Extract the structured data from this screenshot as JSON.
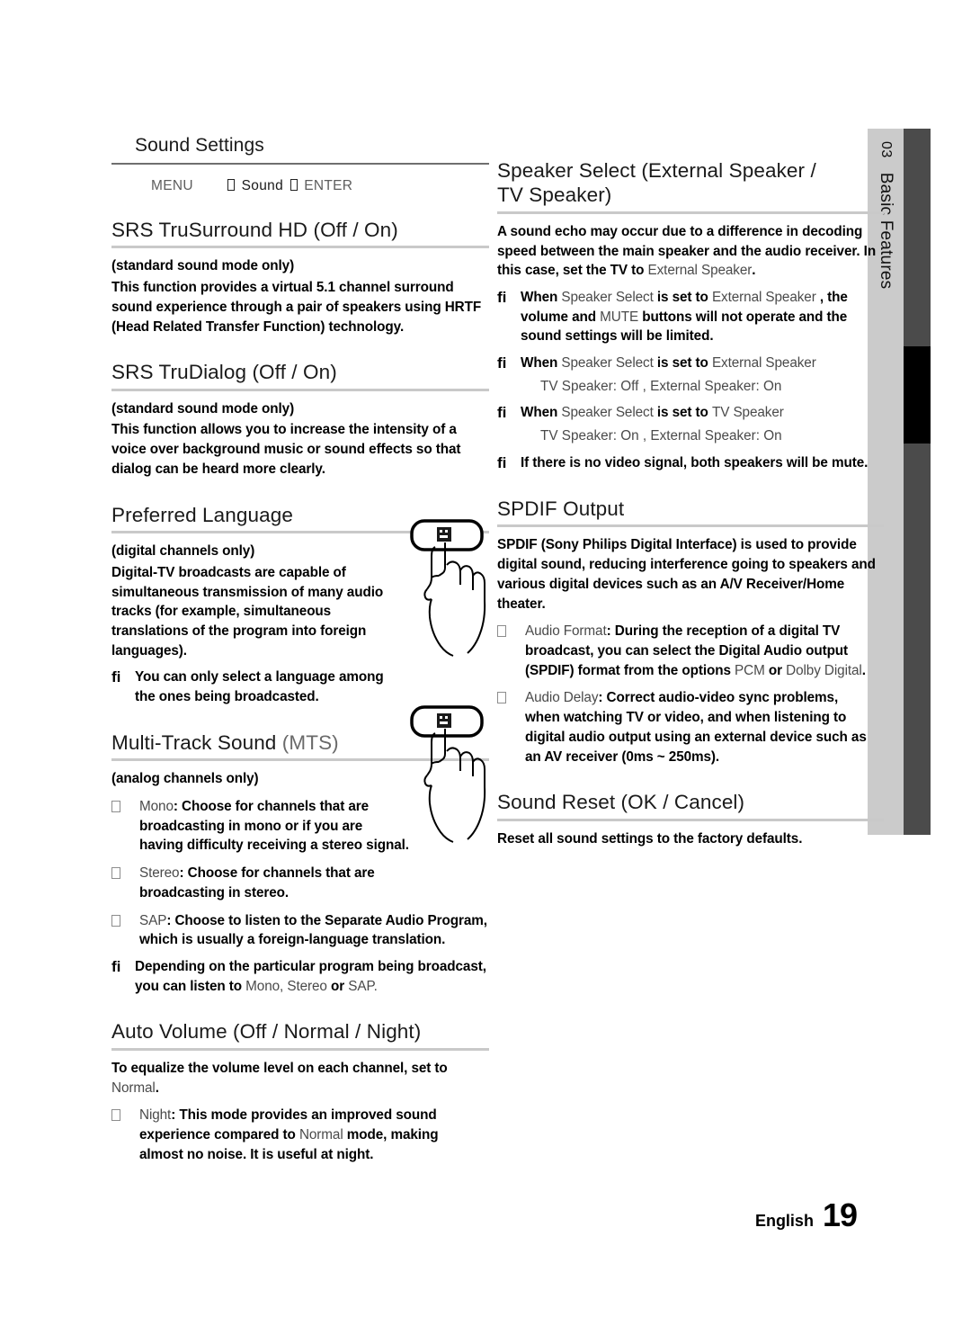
{
  "page": {
    "footer_language": "English",
    "footer_page_number": "19"
  },
  "side_tab": {
    "number": "03",
    "label": "Basic Features",
    "bg_color": "#cbcbcb",
    "bar_color": "#4b4b4b",
    "bar_accent_color": "#000000"
  },
  "section_box": {
    "title": "Sound Settings",
    "path_menu": "MENU",
    "path_middle": "Sound",
    "path_enter": "ENTER"
  },
  "left_column": {
    "srs_trusurround": {
      "heading": "SRS TruSurround HD (Off / On)",
      "note_mode": "(standard sound mode only)",
      "body": "This function provides a virtual 5.1 channel surround sound experience through a pair of speakers using HRTF (Head Related Transfer Function) technology."
    },
    "srs_trudialog": {
      "heading": "SRS TruDialog (Off / On)",
      "note_mode": "(standard sound mode only)",
      "body": "This function allows you to increase the intensity of a voice over background music or sound effects so that dialog can be heard more clearly."
    },
    "preferred_language": {
      "heading": "Preferred Language",
      "note_mode": "(digital channels only)",
      "body": "Digital-TV broadcasts are capable of simultaneous transmission of many audio tracks (for example, simultaneous translations of the program into foreign languages).",
      "note": "You can only select a language among the ones being broadcasted."
    },
    "multi_track_sound": {
      "heading_main": "Multi-Track Sound",
      "heading_light": "(MTS)",
      "note_mode": "(analog channels only)",
      "bullets": [
        {
          "term": "Mono",
          "text": ": Choose for channels that are broadcasting in mono or if you are having difficulty receiving a stereo signal."
        },
        {
          "term": "Stereo",
          "text": ": Choose for channels that are broadcasting in stereo."
        },
        {
          "term": "SAP",
          "text": ": Choose to listen to the Separate Audio Program, which is usually a foreign-language translation."
        }
      ],
      "note_prefix": "Depending on the particular program being broadcast, you can listen to ",
      "note_opt1": "Mono",
      "note_sep1": ", ",
      "note_opt2": "Stereo",
      "note_sep2": " or ",
      "note_opt3": "SAP",
      "note_suffix": "."
    },
    "auto_volume": {
      "heading": "Auto Volume (Off / Normal / Night)",
      "body_prefix": "To equalize the volume level on each channel, set to ",
      "body_value": "Normal",
      "body_suffix": ".",
      "bullet_term": "Night",
      "bullet_text_a": ": This mode provides an improved sound experience compared to ",
      "bullet_value": "Normal",
      "bullet_text_b": " mode, making almost no noise. It is useful at night."
    }
  },
  "right_column": {
    "speaker_select": {
      "heading": "Speaker Select (External Speaker / TV Speaker)",
      "body_prefix": "A sound echo may occur due to a difference in decoding speed between the main speaker and the audio receiver. In this case, set the TV to ",
      "body_value": "External Speaker",
      "body_suffix": ".",
      "note1_a": "When ",
      "note1_v1": "Speaker Select",
      "note1_b": " is set to ",
      "note1_v2": "External Speaker",
      "note1_c": " , the volume and ",
      "note1_v3": "MUTE",
      "note1_d": " buttons will not operate and the sound settings will be limited.",
      "note2_a": "When ",
      "note2_v1": "Speaker Select",
      "note2_b": " is set to ",
      "note2_v2": "External Speaker",
      "note2_sub": "TV Speaker: Off , External Speaker: On",
      "note3_a": "When ",
      "note3_v1": "Speaker Select",
      "note3_b": " is set to ",
      "note3_v2": "TV Speaker",
      "note3_sub": "TV Speaker: On , External Speaker: On",
      "note4": "If there is no video signal, both speakers will be mute."
    },
    "spdif_output": {
      "heading": "SPDIF Output",
      "body": "SPDIF (Sony Philips Digital Interface) is used to provide digital sound, reducing interference going to speakers and various digital devices such as an A/V Receiver/Home theater.",
      "bullet1_term": "Audio Format",
      "bullet1_text_a": ": During the reception of a digital TV broadcast, you can select the Digital Audio output (SPDIF) format from the options ",
      "bullet1_value1": "PCM",
      "bullet1_text_b": " or ",
      "bullet1_value2": "Dolby Digital",
      "bullet1_text_c": ".",
      "bullet2_term": "Audio Delay",
      "bullet2_text": ": Correct audio-video sync problems, when watching TV or video, and when listening to digital audio output using an external device such as an AV receiver (0ms ~ 250ms)."
    },
    "sound_reset": {
      "heading": "Sound Reset (OK / Cancel)",
      "body": "Reset all sound settings to the factory defaults."
    }
  }
}
